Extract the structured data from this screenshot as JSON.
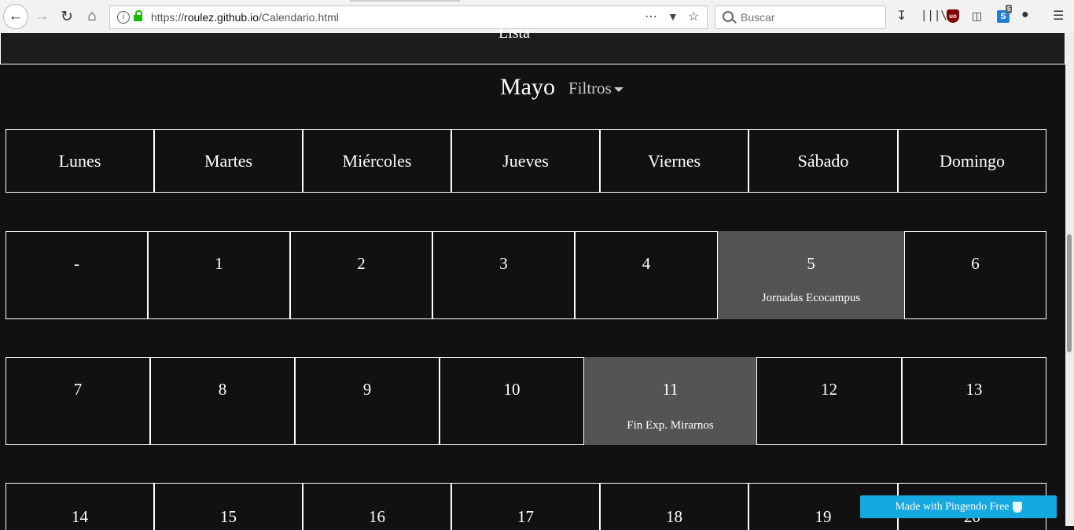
{
  "browser": {
    "url_prefix": "https://",
    "url_domain": "roulez.github.io",
    "url_path": "/Calendario.html",
    "search_placeholder": "Buscar",
    "ext_badge": "5"
  },
  "calendar": {
    "month": "Mayo",
    "filters_label": "Filtros",
    "weekdays": [
      "Lunes",
      "Martes",
      "Miércoles",
      "Jueves",
      "Viernes",
      "Sábado",
      "Domingo"
    ],
    "weeks": [
      [
        {
          "day": "-"
        },
        {
          "day": "1"
        },
        {
          "day": "2"
        },
        {
          "day": "3"
        },
        {
          "day": "4"
        },
        {
          "day": "5",
          "event": "Jornadas Ecocampus"
        },
        {
          "day": "6"
        }
      ],
      [
        {
          "day": "7"
        },
        {
          "day": "8"
        },
        {
          "day": "9"
        },
        {
          "day": "10"
        },
        {
          "day": "11",
          "event": "Fin Exp. Mirarnos"
        },
        {
          "day": "12"
        },
        {
          "day": "13"
        }
      ],
      [
        {
          "day": "14"
        },
        {
          "day": "15"
        },
        {
          "day": "16"
        },
        {
          "day": "17"
        },
        {
          "day": "18"
        },
        {
          "day": "19"
        },
        {
          "day": "20"
        }
      ]
    ]
  },
  "badge": {
    "label": "Made with Pingendo Free"
  },
  "colors": {
    "background": "#111111",
    "event_cell": "#545454",
    "badge": "#16a8e0"
  }
}
